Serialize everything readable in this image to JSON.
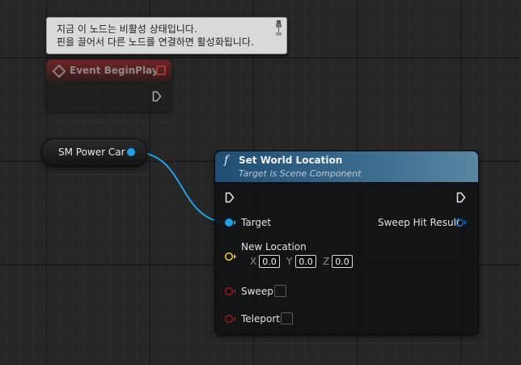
{
  "tooltip": {
    "line1": "지금 이 노드는 비활성 상태입니다.",
    "line2": "핀을 끌어서 다른 노드를 연결하면 활성화됩니다."
  },
  "event_node": {
    "title": "Event BeginPlay",
    "state": "disabled",
    "header_color": "#8a2424"
  },
  "variable_node": {
    "label": "SM Power Car",
    "pin_color": "#1ca3e8"
  },
  "function_node": {
    "icon": "function-icon",
    "title": "Set World Location",
    "subtitle": "Target is Scene Component",
    "header_color": "#3c6d8f",
    "pins": {
      "target": "Target",
      "new_location": "New Location",
      "x_label": "X",
      "x_value": "0.0",
      "y_label": "Y",
      "y_value": "0.0",
      "z_label": "Z",
      "z_value": "0.0",
      "sweep": "Sweep",
      "teleport": "Teleport",
      "sweep_hit_result": "Sweep Hit Result"
    },
    "pin_colors": {
      "object": "#1ca3e8",
      "vector": "#e3c52a",
      "bool": "#8f1c1c",
      "struct": "#0a5fbd"
    }
  }
}
